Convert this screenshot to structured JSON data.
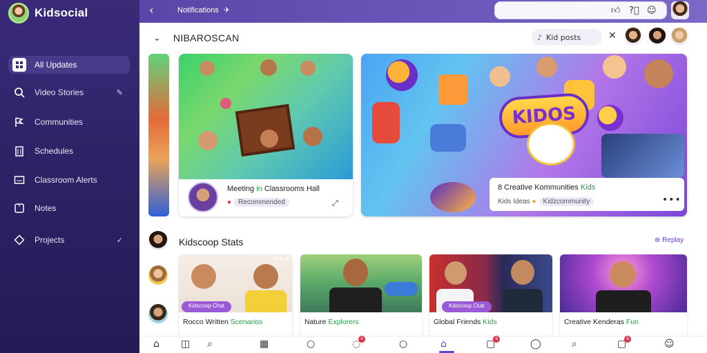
{
  "app": {
    "brand": "Kidsocial"
  },
  "sidebar": {
    "items": [
      {
        "label": "All Updates",
        "icon": "grid-icon",
        "active": true
      },
      {
        "label": "Video Stories",
        "icon": "search-icon",
        "trail": "✎"
      },
      {
        "label": "Communities",
        "icon": "flag-icon"
      },
      {
        "label": "Schedules",
        "icon": "building-icon"
      },
      {
        "label": "Classroom Alerts",
        "icon": "screen-icon"
      },
      {
        "label": "Notes",
        "icon": "note-icon"
      },
      {
        "label": "Projects",
        "icon": "diamond-icon",
        "trail": "✓"
      }
    ]
  },
  "topbar": {
    "title": "Notifications",
    "title_icon": "send-icon"
  },
  "main": {
    "section_title": "NIBAROSCAN",
    "chip_label": "Kid posts",
    "banner_a": {
      "title_pre": "Meeting ",
      "title_hl": "in",
      "title_post": " Classrooms Hall",
      "sub": "Recommended"
    },
    "banner_b": {
      "title_pre": "8 Creative Kommunities ",
      "title_hl": "Kids",
      "sub": "Kids Ideas",
      "sub2": "Kidzcommunity",
      "logo": "KIDOS"
    },
    "row2_title": "Kidscoop Stats",
    "reply_label": "Replay",
    "videos": [
      {
        "tag": "Kidscoop Chat",
        "title_pre": "Rocco Written ",
        "title_hl": "Scenarios"
      },
      {
        "tag": "",
        "title_pre": "Nature ",
        "title_hl": "Explorers"
      },
      {
        "tag": "Kidscoop Club",
        "title_pre": "Global Friends ",
        "title_hl": "Kids"
      },
      {
        "tag": "",
        "title_pre": "Creative Kenderas ",
        "title_hl": "Fun"
      }
    ]
  },
  "bottom_nav": {
    "badges": [
      "6",
      "6",
      "6"
    ]
  },
  "colors": {
    "accent": "#6a3fd0",
    "sidebar_bg": "#2c2163",
    "highlight": "#2b9a4a"
  }
}
